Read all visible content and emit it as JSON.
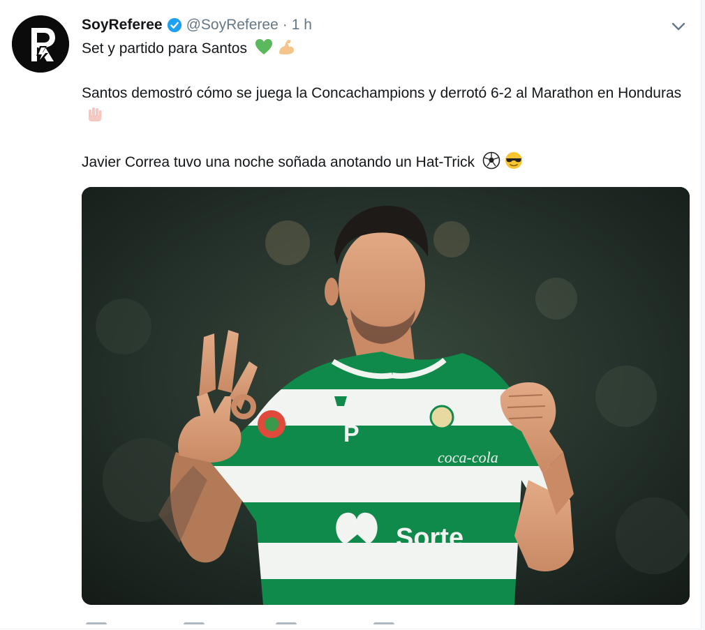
{
  "tweet": {
    "display_name": "SoyReferee",
    "handle": "@SoyReferee",
    "separator": "·",
    "time": "1 h",
    "line1": "Set y partido para Santos",
    "line2": "Santos demostró cómo se juega la Concachampions y derrotó 6-2 al Marathon en Honduras",
    "line3": "Javier Correa tuvo una noche soñada anotando un Hat-Trick",
    "line1_emojis": [
      "green-heart-icon",
      "flexed-biceps-icon"
    ],
    "line2_emojis": [
      "raised-hand-icon"
    ],
    "line3_emojis": [
      "soccer-ball-icon",
      "sunglasses-face-icon"
    ]
  },
  "media": {
    "jersey_text": "Sorte",
    "jersey_sponsor": "coca-cola"
  },
  "actions": [
    "reply-icon",
    "retweet-icon",
    "like-icon",
    "share-icon"
  ],
  "colors": {
    "verified": "#1da1f2",
    "jersey_green": "#0f8a4a",
    "link_gray": "#657786"
  }
}
